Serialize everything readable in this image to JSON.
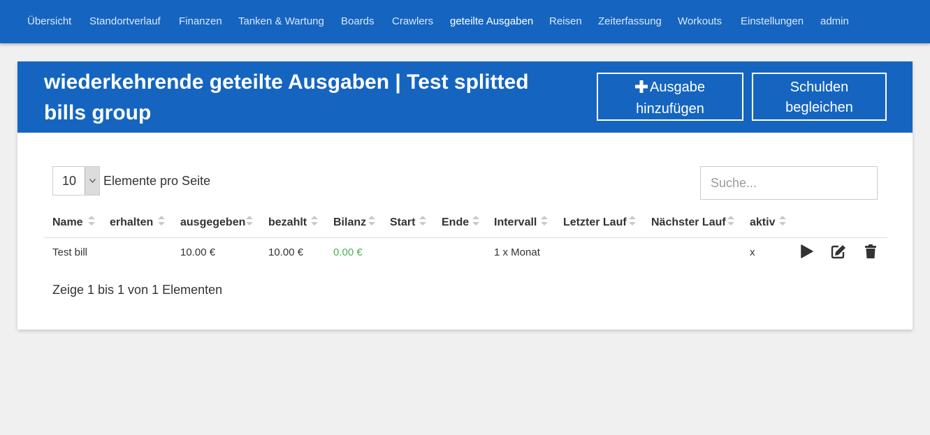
{
  "nav": {
    "items": [
      {
        "label": "Übersicht"
      },
      {
        "label": "Standortverlauf"
      },
      {
        "label": "Finanzen"
      },
      {
        "label": "Tanken & Wartung"
      },
      {
        "label": "Boards"
      },
      {
        "label": "Crawlers"
      },
      {
        "label": "geteilte Ausgaben",
        "active": true
      },
      {
        "label": "Reisen"
      },
      {
        "label": "Zeiterfassung"
      },
      {
        "label": "Workouts"
      },
      {
        "label": "Einstellungen"
      },
      {
        "label": "admin"
      }
    ]
  },
  "page": {
    "title": "wiederkehrende geteilte Ausgaben | Test splitted bills group",
    "add_button_line1": "Ausgabe",
    "add_button_line2": "hinzufügen",
    "add_icon": "plus-icon",
    "settle_button_line1": "Schulden",
    "settle_button_line2": "begleichen"
  },
  "table_controls": {
    "page_length": "10",
    "page_length_label": "Elemente pro Seite",
    "search_placeholder": "Suche...",
    "info": "Zeige 1 bis 1 von 1 Elementen"
  },
  "table": {
    "columns": [
      "Name",
      "erhalten",
      "ausgegeben",
      "bezahlt",
      "Bilanz",
      "Start",
      "Ende",
      "Intervall",
      "Letzter Lauf",
      "Nächster Lauf",
      "aktiv"
    ],
    "rows": [
      {
        "name": "Test bill",
        "erhalten": "",
        "ausgegeben": "10.00 €",
        "bezahlt": "10.00 €",
        "bilanz": "0.00 €",
        "start": "",
        "ende": "",
        "intervall": "1 x Monat",
        "letzter_lauf": "",
        "naechster_lauf": "",
        "aktiv": "x",
        "actions": [
          "play-icon",
          "edit-icon",
          "trash-icon"
        ]
      }
    ]
  },
  "colors": {
    "primary": "#1565c0",
    "positive": "#4caf50",
    "background": "#f0f0f0"
  }
}
